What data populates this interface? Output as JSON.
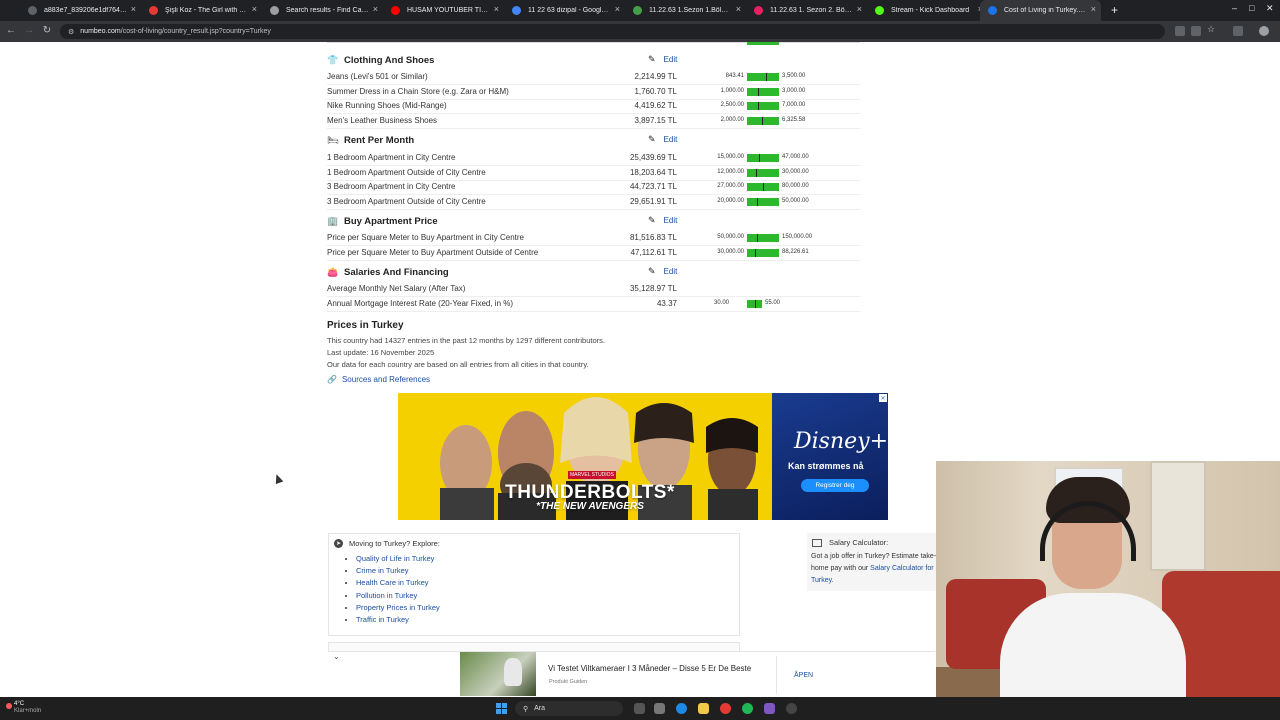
{
  "browser": {
    "tabs": [
      {
        "title": "a883e7_839206e1df7640d884",
        "favicon_color": "#5f6368"
      },
      {
        "title": "Şişli Koz - The Girl with the Nee",
        "favicon_color": "#e53935"
      },
      {
        "title": "Search results - Find Case Law",
        "favicon_color": "#9e9e9e"
      },
      {
        "title": "HUSAM YOUTUBER TİER LİST",
        "favicon_color": "#ff0000"
      },
      {
        "title": "11 22 63 dizipal - Google'da ara",
        "favicon_color": "#4285f4"
      },
      {
        "title": "11.22.63 1.Sezon 1.Bölüm - Diz",
        "favicon_color": "#43a047"
      },
      {
        "title": "11.22.63 1. Sezon 2. Bölüm izle",
        "favicon_color": "#e91e63"
      },
      {
        "title": "Stream - Kick Dashboard",
        "favicon_color": "#53fc18"
      },
      {
        "title": "Cost of Living in Turkey. Prices",
        "favicon_color": "#1a73e8",
        "active": true
      }
    ],
    "url_host": "numbeo.com",
    "url_path": "/cost-of-living/country_result.jsp?country=Turkey",
    "new_tab_label": "+"
  },
  "sections": {
    "clothing": {
      "title": "Clothing And Shoes",
      "icon": "shirt-icon",
      "edit": "Edit",
      "rows": [
        {
          "label": "Jeans (Levi's 501 or Similar)",
          "price": "2,214.99 TL",
          "min": "843.41",
          "max": "3,500.00"
        },
        {
          "label": "Summer Dress in a Chain Store (e.g. Zara or H&M)",
          "price": "1,760.70 TL",
          "min": "1,000.00",
          "max": "3,000.00"
        },
        {
          "label": "Nike Running Shoes (Mid-Range)",
          "price": "4,419.62 TL",
          "min": "2,500.00",
          "max": "7,000.00"
        },
        {
          "label": "Men's Leather Business Shoes",
          "price": "3,897.15 TL",
          "min": "2,000.00",
          "max": "6,325.58"
        }
      ]
    },
    "rent": {
      "title": "Rent Per Month",
      "icon": "bed-icon",
      "edit": "Edit",
      "rows": [
        {
          "label": "1 Bedroom Apartment in City Centre",
          "price": "25,439.69 TL",
          "min": "15,000.00",
          "max": "47,000.00"
        },
        {
          "label": "1 Bedroom Apartment Outside of City Centre",
          "price": "18,203.64 TL",
          "min": "12,000.00",
          "max": "30,000.00"
        },
        {
          "label": "3 Bedroom Apartment in City Centre",
          "price": "44,723.71 TL",
          "min": "27,000.00",
          "max": "80,000.00"
        },
        {
          "label": "3 Bedroom Apartment Outside of City Centre",
          "price": "29,651.91 TL",
          "min": "20,000.00",
          "max": "50,000.00"
        }
      ]
    },
    "buy": {
      "title": "Buy Apartment Price",
      "icon": "building-icon",
      "edit": "Edit",
      "rows": [
        {
          "label": "Price per Square Meter to Buy Apartment in City Centre",
          "price": "81,516.83 TL",
          "min": "50,000.00",
          "max": "150,000.00"
        },
        {
          "label": "Price per Square Meter to Buy Apartment Outside of Centre",
          "price": "47,112.61 TL",
          "min": "30,000.00",
          "max": "88,226.61"
        }
      ]
    },
    "salaries": {
      "title": "Salaries And Financing",
      "icon": "wallet-icon",
      "edit": "Edit",
      "rows": [
        {
          "label": "Average Monthly Net Salary (After Tax)",
          "price": "35,128.97 TL",
          "min": "",
          "max": ""
        },
        {
          "label": "Annual Mortgage Interest Rate (20-Year Fixed, in %)",
          "price": "43.37",
          "min": "30.00",
          "max": "55.00"
        }
      ]
    }
  },
  "prices_info": {
    "title": "Prices in Turkey",
    "line1": "This country had 14327 entries in the past 12 months by 1297 different contributors.",
    "line2": "Last update: 16 November 2025",
    "line3": "Our data for each country are based on all entries from all cities in that country.",
    "sources_link": "Sources and References"
  },
  "ad_banner": {
    "studio": "MARVEL STUDIOS",
    "title": "THUNDERBOLTS*",
    "subtitle": "*THE NEW AVENGERS",
    "brand": "Disney+",
    "tagline": "Kan strømmes nå",
    "cta": "Registrer deg"
  },
  "explore": {
    "heading": "Moving to Turkey? Explore:",
    "links": [
      "Quality of Life in Turkey",
      "Crime in Turkey",
      "Health Care in Turkey",
      "Pollution in Turkey",
      "Property Prices in Turkey",
      "Traffic in Turkey"
    ]
  },
  "salary_calc": {
    "heading": "Salary Calculator:",
    "text_before": "Got a job offer in Turkey? Estimate take-home pay with our ",
    "link": "Salary Calculator for Turkey",
    "text_after": "."
  },
  "sticky_ad": {
    "title": "Vi Testet Viltkameraer I 3 Måneder – Disse 5 Er De Beste",
    "source": "Produkt Guiden",
    "open": "ÅPEN"
  },
  "taskbar": {
    "temp": "4°C",
    "weather_text": "Klar+moln",
    "search": "Ara"
  }
}
